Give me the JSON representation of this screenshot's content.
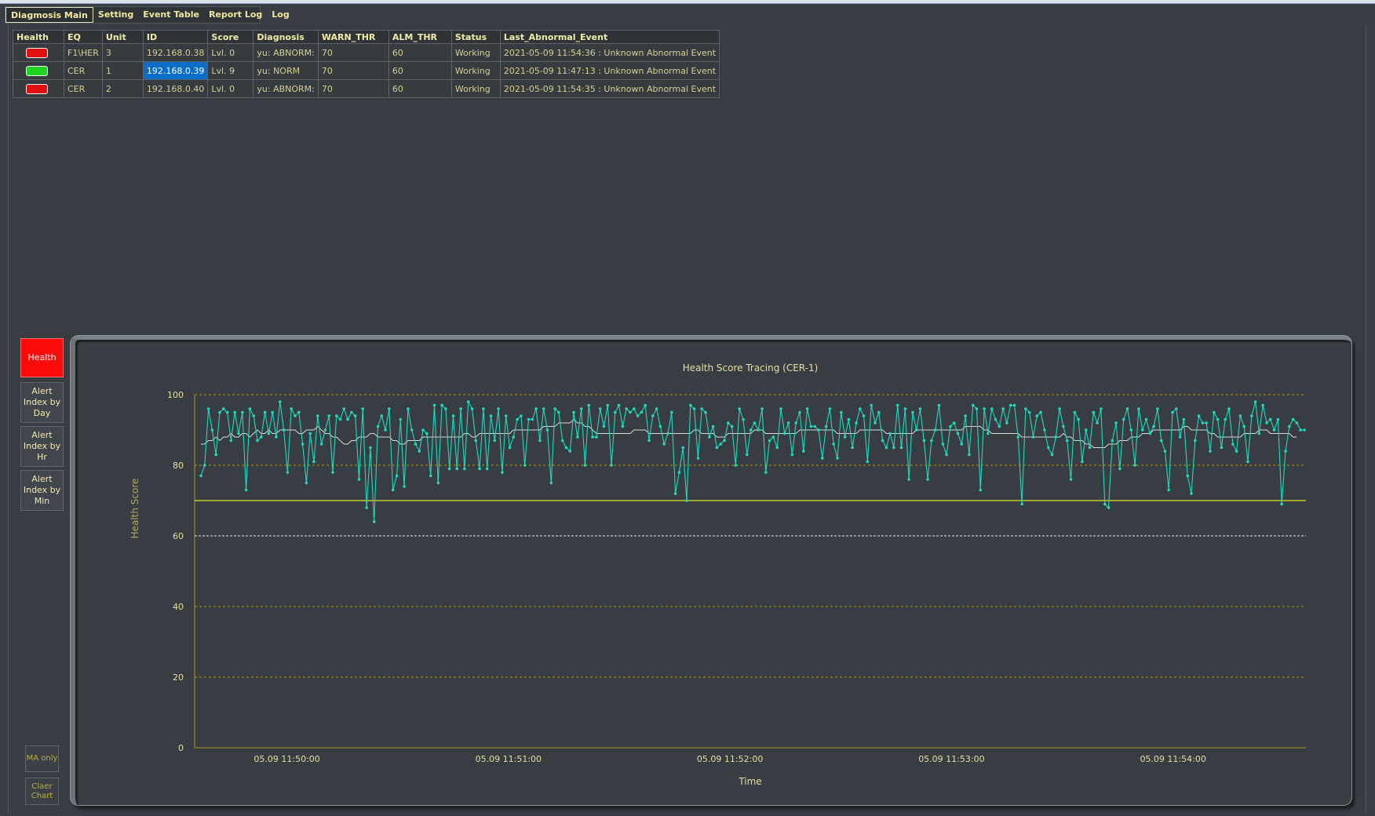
{
  "tabs": [
    {
      "label": "Diagmosis Main",
      "active": true
    },
    {
      "label": "Setting",
      "active": false
    },
    {
      "label": "Event Table",
      "active": false
    },
    {
      "label": "Report Log",
      "active": false
    },
    {
      "label": "Log",
      "active": false
    }
  ],
  "table": {
    "columns": [
      "Health",
      "EQ",
      "Unit",
      "ID",
      "Score",
      "Diagnosis",
      "WARN_THR",
      "ALM_THR",
      "Status",
      "Last_Abnormal_Event"
    ],
    "rows": [
      {
        "health": "red",
        "eq": "F1\\HER",
        "unit": "3",
        "id": "192.168.0.38",
        "score": "Lvl. 0",
        "diagnosis": "yu: ABNORM:",
        "warn": "70",
        "alm": "60",
        "status": "Working",
        "last": "2021-05-09 11:54:36 : Unknown Abnormal Event"
      },
      {
        "health": "green",
        "eq": "CER",
        "unit": "1",
        "id": "192.168.0.39",
        "score": "Lvl. 9",
        "diagnosis": "yu: NORM",
        "warn": "70",
        "alm": "60",
        "status": "Working",
        "last": "2021-05-09 11:47:13 : Unknown Abnormal Event"
      },
      {
        "health": "red",
        "eq": "CER",
        "unit": "2",
        "id": "192.168.0.40",
        "score": "Lvl. 0",
        "diagnosis": "yu: ABNORM:",
        "warn": "70",
        "alm": "60",
        "status": "Working",
        "last": "2021-05-09 11:54:35 : Unknown Abnormal Event"
      }
    ]
  },
  "side_buttons": {
    "health": "Health",
    "day": "Alert Index by Day",
    "hr": "Alert Index by Hr",
    "min": "Alert Index by Min",
    "ma": "MA only",
    "clear": "Claer Chart"
  },
  "colors": {
    "series": "#23d8c0",
    "ma": "#d9d9d9",
    "warn_line": "#e6e62a",
    "alarm_line": "#e8e8f0",
    "grid": "#a99622",
    "health_button": "#ff0a0a"
  },
  "chart_data": {
    "type": "line",
    "title": "Health Score Tracing (CER-1)",
    "xlabel": "Time",
    "ylabel": "Health Score",
    "ylim": [
      0,
      100
    ],
    "yticks": [
      0,
      20,
      40,
      60,
      80,
      100
    ],
    "xticks": [
      "05.09 11:50:00",
      "05.09 11:51:00",
      "05.09 11:52:00",
      "05.09 11:53:00",
      "05.09 11:54:00"
    ],
    "x_range": [
      "05.09 11:49:35",
      "05.09 11:54:36"
    ],
    "warn_threshold": 70,
    "alarm_threshold": 60,
    "series": [
      {
        "values": [
          77,
          80,
          96,
          90,
          83,
          95,
          96,
          95,
          87,
          95,
          89,
          95,
          73,
          96,
          94,
          87,
          88,
          95,
          89,
          95,
          88,
          98,
          90,
          78,
          96,
          94,
          95,
          86,
          75,
          89,
          81,
          94,
          86,
          90,
          94,
          78,
          94,
          93,
          96,
          93,
          95,
          94,
          76,
          96,
          68,
          85,
          64,
          91,
          94,
          90,
          96,
          73,
          77,
          93,
          74,
          96,
          90,
          86,
          84,
          90,
          89,
          77,
          97,
          75,
          97,
          96,
          79,
          94,
          79,
          96,
          79,
          98,
          96,
          87,
          79,
          96,
          79,
          94,
          87,
          96,
          78,
          94,
          85,
          88,
          93,
          94,
          80,
          93,
          93,
          96,
          87,
          96,
          90,
          75,
          96,
          95,
          87,
          85,
          84,
          95,
          88,
          96,
          80,
          97,
          88,
          88,
          96,
          91,
          97,
          80,
          95,
          97,
          91,
          96,
          95,
          96,
          94,
          95,
          97,
          87,
          94,
          96,
          91,
          86,
          89,
          95,
          72,
          78,
          85,
          70,
          97,
          96,
          82,
          96,
          95,
          88,
          91,
          85,
          86,
          87,
          92,
          91,
          80,
          96,
          93,
          83,
          90,
          92,
          90,
          96,
          78,
          87,
          88,
          85,
          96,
          89,
          92,
          83,
          92,
          95,
          84,
          96,
          91,
          91,
          90,
          82,
          91,
          96,
          86,
          82,
          95,
          88,
          93,
          85,
          92,
          96,
          94,
          81,
          97,
          92,
          95,
          87,
          85,
          89,
          85,
          97,
          85,
          96,
          76,
          95,
          90,
          96,
          87,
          76,
          87,
          90,
          97,
          86,
          83,
          91,
          92,
          89,
          86,
          94,
          83,
          97,
          96,
          73,
          96,
          89,
          96,
          93,
          91,
          96,
          92,
          97,
          97,
          88,
          69,
          96,
          95,
          88,
          94,
          95,
          90,
          85,
          83,
          88,
          96,
          91,
          87,
          76,
          95,
          93,
          81,
          90,
          85,
          95,
          92,
          96,
          69,
          68,
          87,
          92,
          79,
          93,
          96,
          90,
          80,
          96,
          90,
          93,
          89,
          91,
          96,
          87,
          84,
          73,
          95,
          96,
          88,
          93,
          77,
          72,
          87,
          94,
          92,
          92,
          84,
          95,
          93,
          85,
          93,
          96,
          86,
          84,
          94,
          91,
          81,
          94,
          98,
          89,
          97,
          92,
          93,
          90,
          93,
          69,
          84,
          91,
          93,
          92,
          90,
          90
        ],
        "ma": [
          86,
          86,
          87,
          87,
          88,
          87,
          88,
          88,
          89,
          88,
          88,
          89,
          89,
          88,
          89,
          90,
          89,
          89,
          90,
          89,
          89,
          90,
          90,
          90,
          90,
          90,
          89,
          89,
          90,
          90,
          90,
          91,
          90,
          89,
          89,
          88,
          88,
          87,
          86,
          86,
          87,
          87,
          88,
          88,
          88,
          89,
          89,
          88,
          88,
          88,
          88,
          87,
          87,
          86,
          86,
          87,
          87,
          87,
          87,
          88,
          88,
          88,
          88,
          88,
          88,
          88,
          88,
          88,
          88,
          88,
          89,
          89,
          88,
          88,
          89,
          89,
          89,
          89,
          89,
          89,
          89,
          89,
          89,
          90,
          90,
          90,
          90,
          90,
          90,
          90,
          90,
          91,
          91,
          91,
          91,
          92,
          92,
          92,
          92,
          93,
          92,
          92,
          91,
          91,
          90,
          89,
          89,
          89,
          89,
          89,
          89,
          89,
          89,
          89,
          89,
          90,
          90,
          90,
          90,
          89,
          89,
          89,
          89,
          89,
          89,
          89,
          89,
          89,
          89,
          89,
          89,
          90,
          90,
          89,
          89,
          89,
          89,
          88,
          88,
          88,
          89,
          89,
          89,
          89,
          89,
          89,
          89,
          90,
          90,
          90,
          89,
          89,
          89,
          89,
          89,
          89,
          89,
          89,
          89,
          90,
          90,
          90,
          90,
          90,
          90,
          90,
          90,
          90,
          90,
          89,
          89,
          89,
          89,
          89,
          89,
          90,
          90,
          90,
          90,
          90,
          90,
          90,
          89,
          89,
          89,
          89,
          89,
          89,
          89,
          89,
          90,
          90,
          90,
          90,
          90,
          90,
          90,
          90,
          90,
          90,
          90,
          90,
          90,
          91,
          91,
          91,
          91,
          91,
          90,
          90,
          89,
          89,
          89,
          89,
          89,
          89,
          89,
          89,
          88,
          88,
          88,
          88,
          88,
          88,
          88,
          88,
          88,
          88,
          88,
          89,
          88,
          88,
          87,
          87,
          87,
          86,
          86,
          85,
          85,
          85,
          85,
          86,
          86,
          86,
          87,
          87,
          87,
          88,
          88,
          88,
          89,
          89,
          89,
          90,
          90,
          90,
          90,
          90,
          90,
          90,
          90,
          91,
          91,
          90,
          90,
          90,
          90,
          90,
          89,
          89,
          88,
          88,
          88,
          88,
          88,
          88,
          88,
          89,
          89,
          89,
          89,
          90,
          90,
          90,
          89,
          89,
          89,
          89,
          89,
          89,
          88,
          88
        ]
      }
    ]
  }
}
